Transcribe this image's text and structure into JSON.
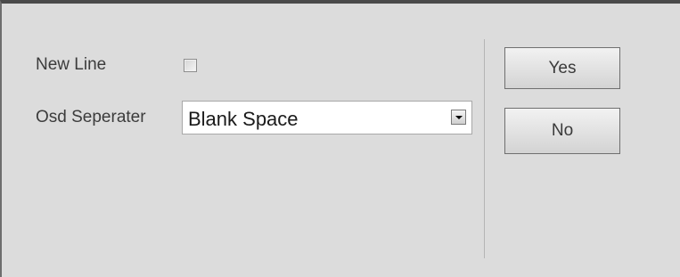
{
  "dialog": {
    "new_line": {
      "label": "New Line",
      "checked": false
    },
    "osd_separator": {
      "label": "Osd Seperater",
      "selected": "Blank Space"
    },
    "buttons": {
      "yes": "Yes",
      "no": "No"
    }
  },
  "icons": {
    "dropdown": "chevron-down-icon"
  },
  "colors": {
    "panel_bg": "#dcdcdc",
    "top_border": "#4a4a4a"
  }
}
